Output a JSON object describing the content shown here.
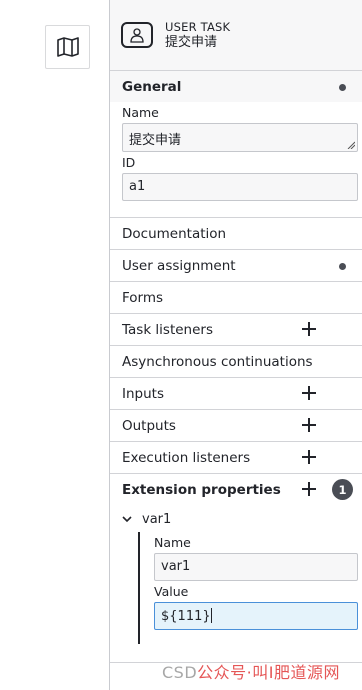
{
  "header": {
    "type": "USER TASK",
    "name": "提交申请"
  },
  "general": {
    "title": "General",
    "name_label": "Name",
    "name_value": "提交申请",
    "id_label": "ID",
    "id_value": "a1"
  },
  "groups": {
    "documentation": "Documentation",
    "user_assignment": "User assignment",
    "forms": "Forms",
    "task_listeners": "Task listeners",
    "async": "Asynchronous continuations",
    "inputs": "Inputs",
    "outputs": "Outputs",
    "execution_listeners": "Execution listeners",
    "extension_properties": "Extension properties"
  },
  "extension": {
    "count": "1",
    "item_title": "var1",
    "name_label": "Name",
    "name_value": "var1",
    "value_label": "Value",
    "value_value": "${111}"
  },
  "watermark": {
    "prefix": "CSD",
    "text": "公众号·叫I肥道源网"
  },
  "icons": {
    "map": "map-icon",
    "user_task": "user-task-icon",
    "add": "plus-icon",
    "expand": "chevron-down-icon"
  },
  "colors": {
    "header_bg": "#f7f7f8",
    "badge": "#4a4d55",
    "focus_bg": "#e5f3fb",
    "focus_border": "#4a90d9"
  }
}
